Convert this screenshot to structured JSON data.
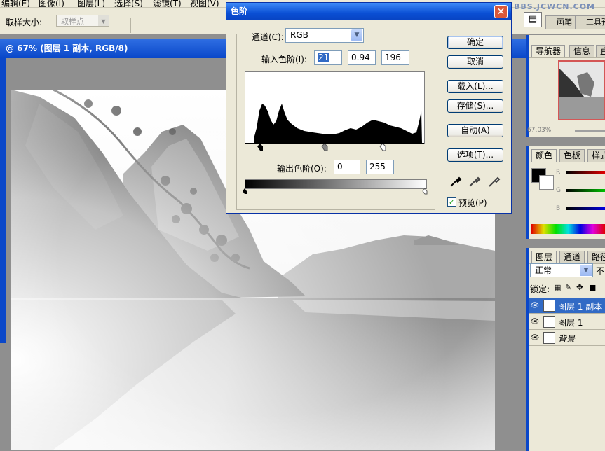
{
  "menu": [
    "编辑(E)",
    "图像(I)",
    "图层(L)",
    "选择(S)",
    "滤镜(T)",
    "视图(V)"
  ],
  "options": {
    "sample_size_label": "取样大小:",
    "sample_size_value": "取样点"
  },
  "watermark": "BBS.JCWCN.COM",
  "panel_well_tabs": [
    "画笔",
    "工具预"
  ],
  "document": {
    "title": "@ 67% (图层 1 副本, RGB/8)"
  },
  "levels_dialog": {
    "title": "色阶",
    "channel_label": "通道(C):",
    "channel_value": "RGB",
    "input_label": "输入色阶(I):",
    "input_black": "21",
    "input_gamma": "0.94",
    "input_white": "196",
    "output_label": "输出色阶(O):",
    "output_black": "0",
    "output_white": "255",
    "buttons": {
      "ok": "确定",
      "cancel": "取消",
      "load": "载入(L)...",
      "save": "存储(S)...",
      "auto": "自动(A)",
      "options": "选项(T)..."
    },
    "preview_label": "预览(P)",
    "preview_checked": true
  },
  "navigator_panel": {
    "tabs": [
      "导航器",
      "信息",
      "直"
    ],
    "zoom": "67.03%"
  },
  "color_panel": {
    "tabs": [
      "颜色",
      "色板",
      "样式"
    ],
    "channels": [
      "R",
      "G",
      "B"
    ]
  },
  "layers_panel": {
    "tabs": [
      "图层",
      "通道",
      "路径"
    ],
    "blend_mode": "正常",
    "opacity_label": "不",
    "lock_label": "锁定:",
    "layers": [
      {
        "name": "图层 1 副本",
        "selected": true
      },
      {
        "name": "图层 1",
        "selected": false
      },
      {
        "name": "背景",
        "selected": false
      }
    ]
  },
  "colors": {
    "titlebar_blue": "#0a47c9",
    "dialog_face": "#ece9d8",
    "selection": "#316ac5"
  }
}
